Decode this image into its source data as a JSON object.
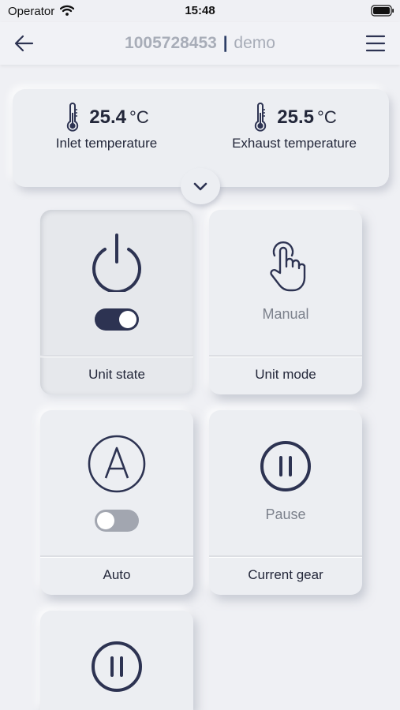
{
  "status_bar": {
    "carrier": "Operator",
    "time": "15:48"
  },
  "nav": {
    "device_id": "1005728453",
    "separator": "|",
    "device_name": "demo"
  },
  "temperatures": {
    "inlet": {
      "value": "25.4",
      "unit": "°C",
      "label": "Inlet temperature"
    },
    "exhaust": {
      "value": "25.5",
      "unit": "°C",
      "label": "Exhaust temperature"
    }
  },
  "tiles": {
    "unit_state": {
      "label": "Unit state",
      "toggle_on": true
    },
    "unit_mode": {
      "label": "Unit mode",
      "value": "Manual"
    },
    "auto": {
      "label": "Auto",
      "toggle_on": false
    },
    "current_gear": {
      "label": "Current gear",
      "value": "Pause"
    }
  },
  "colors": {
    "background": "#eff0f4",
    "tile": "#eceef2",
    "accent_dark": "#2d3352",
    "muted_text": "#7c818c",
    "title_gray": "#a8adb8"
  }
}
